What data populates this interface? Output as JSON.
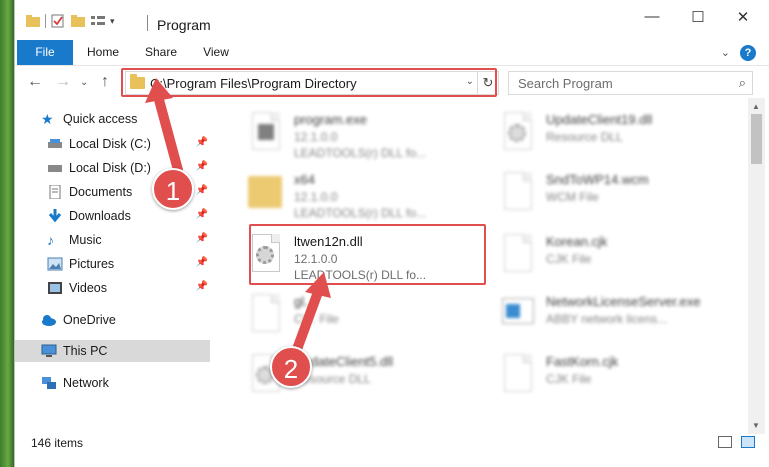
{
  "window": {
    "title": "Program",
    "controls": {
      "minimize": "—",
      "maximize": "☐",
      "close": "✕"
    }
  },
  "ribbon": {
    "tabs": [
      "File",
      "Home",
      "Share",
      "View"
    ],
    "expand": "⌄",
    "help": "?"
  },
  "navigation": {
    "back": "←",
    "forward": "→",
    "recent": "⌄",
    "up": "↑",
    "address": "C:\\Program Files\\Program Directory",
    "refresh": "↻",
    "search_placeholder": "Search Program"
  },
  "sidebar": {
    "quick_access": "Quick access",
    "pinned": [
      {
        "label": "Local Disk (C:)",
        "icon": "drive-icon"
      },
      {
        "label": "Local Disk (D:)",
        "icon": "drive-icon"
      },
      {
        "label": "Documents",
        "icon": "documents-icon"
      },
      {
        "label": "Downloads",
        "icon": "downloads-icon"
      },
      {
        "label": "Music",
        "icon": "music-icon"
      },
      {
        "label": "Pictures",
        "icon": "pictures-icon"
      },
      {
        "label": "Videos",
        "icon": "videos-icon"
      }
    ],
    "onedrive": "OneDrive",
    "this_pc": "This PC",
    "network": "Network"
  },
  "files": [
    {
      "name": "program.exe",
      "line2": "12.1.0.0",
      "line3": "LEADTOOLS(r) DLL fo...",
      "icon": "exe-icon"
    },
    {
      "name": "x64",
      "line2": "12.1.0.0",
      "line3": "LEADTOOLS(r) DLL fo...",
      "icon": "folder-icon"
    },
    {
      "name": "ltwen12n.dll",
      "line2": "12.1.0.0",
      "line3": "LEADTOOLS(r) DLL fo...",
      "icon": "dll-gear-icon"
    },
    {
      "name": "gl...",
      "line2": "CI... File",
      "line3": "",
      "icon": "file-icon"
    },
    {
      "name": "UpdateClient5.dll",
      "line2": "Resource DLL",
      "line3": "",
      "icon": "dll-gear-icon"
    },
    {
      "name": "UpdateClient19.dll",
      "line2": "Resource DLL",
      "line3": "",
      "icon": "dll-gear-icon"
    },
    {
      "name": "SndToWP14.wcm",
      "line2": "WCM File",
      "line3": "",
      "icon": "file-icon"
    },
    {
      "name": "Korean.cjk",
      "line2": "CJK File",
      "line3": "",
      "icon": "file-icon"
    },
    {
      "name": "NetworkLicenseServer.exe",
      "line2": "ABBY network licens...",
      "line3": "",
      "icon": "app-icon"
    },
    {
      "name": "FastKorn.cjk",
      "line2": "CJK File",
      "line3": "",
      "icon": "file-icon"
    }
  ],
  "status": {
    "items": "146 items"
  },
  "callouts": [
    "1",
    "2"
  ],
  "colors": {
    "accent": "#1979ca",
    "highlight": "#e04e4e",
    "folder": "#e8c15a"
  }
}
